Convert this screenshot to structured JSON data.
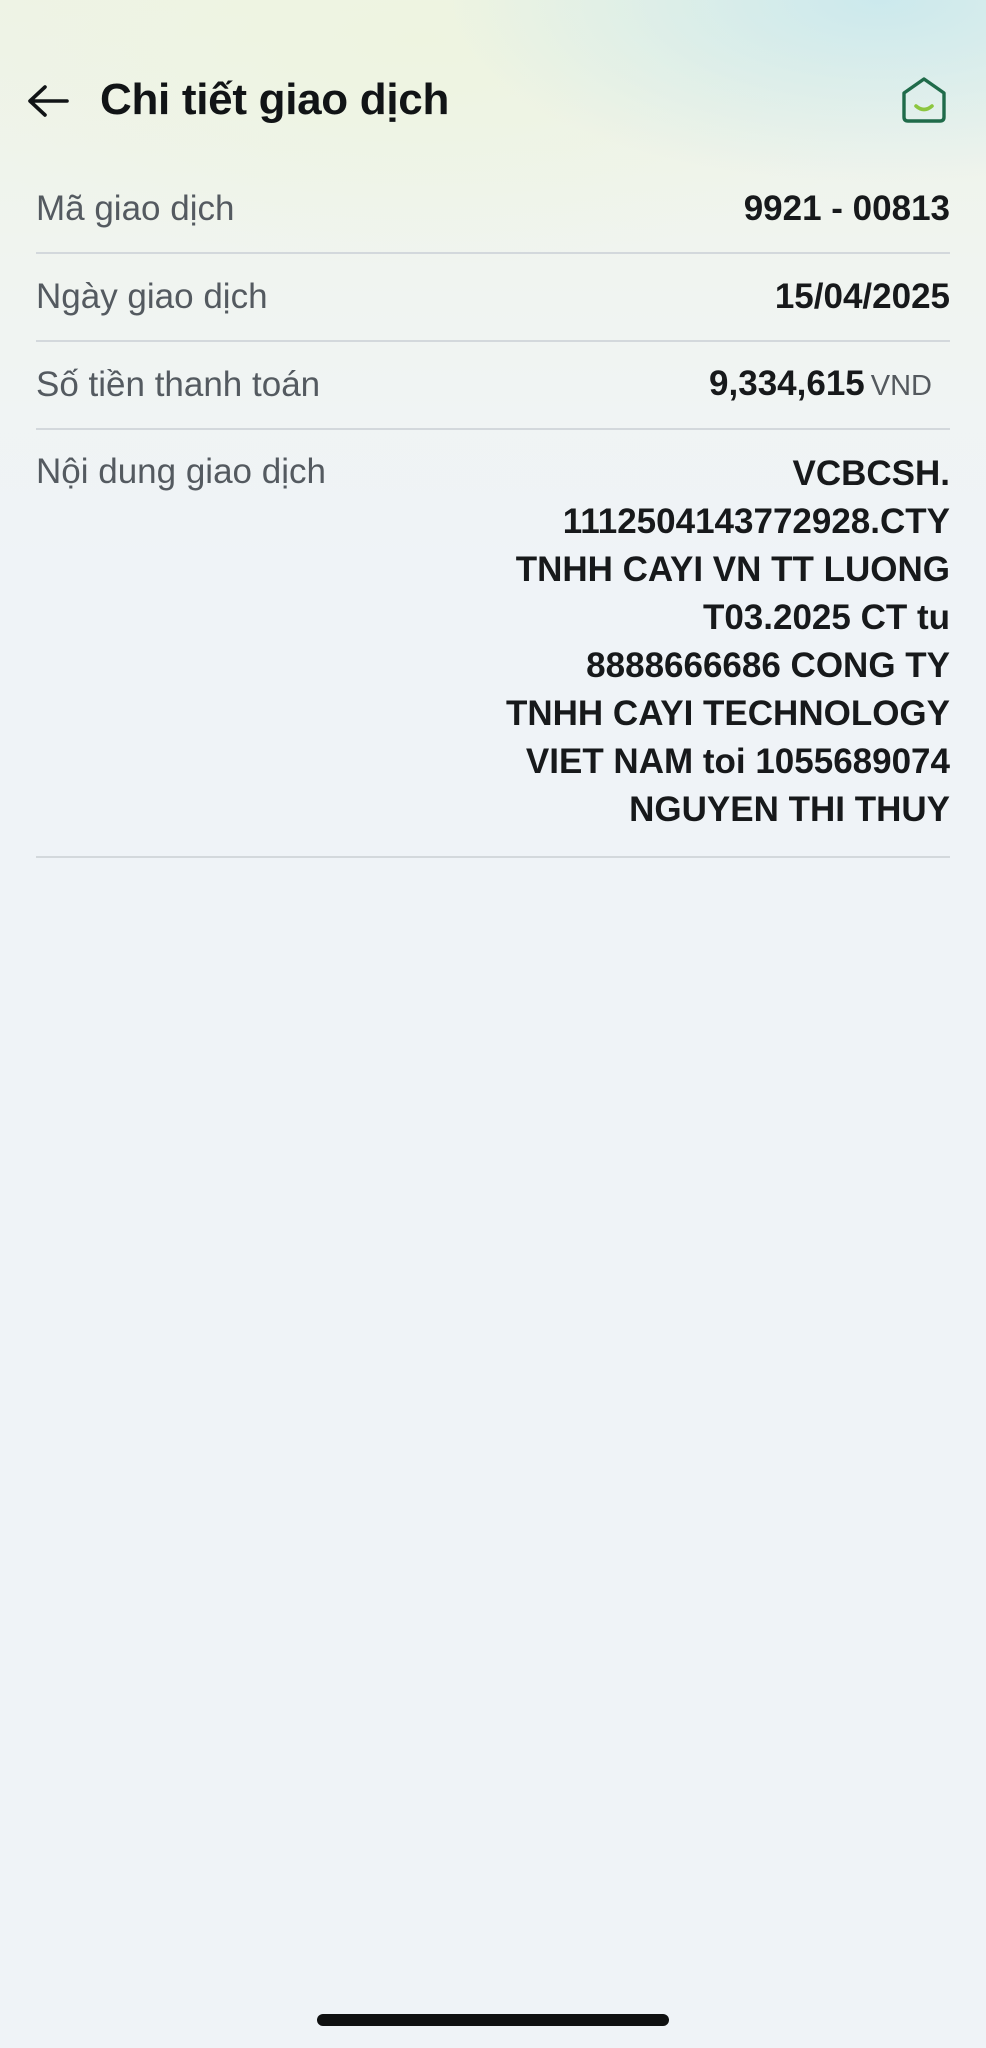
{
  "header": {
    "title": "Chi tiết giao dịch",
    "back_icon": "arrow-left-icon",
    "home_icon": "home-icon",
    "home_accent": "#8cc63f",
    "home_outline": "#1f6b4a"
  },
  "details": {
    "transaction_id": {
      "label": "Mã giao dịch",
      "value": "9921 - 00813"
    },
    "transaction_date": {
      "label": "Ngày giao dịch",
      "value": "15/04/2025"
    },
    "amount": {
      "label": "Số tiền thanh toán",
      "value": "9,334,615",
      "unit": "VND"
    },
    "content": {
      "label": "Nội dung giao dịch",
      "lines": [
        "VCBCSH.",
        "1112504143772928.CTY",
        "TNHH CAYI VN TT LUONG",
        "T03.2025 CT tu",
        "8888666686 CONG TY",
        "TNHH CAYI TECHNOLOGY",
        "VIET NAM toi 1055689074",
        "NGUYEN THI THUY"
      ]
    }
  }
}
